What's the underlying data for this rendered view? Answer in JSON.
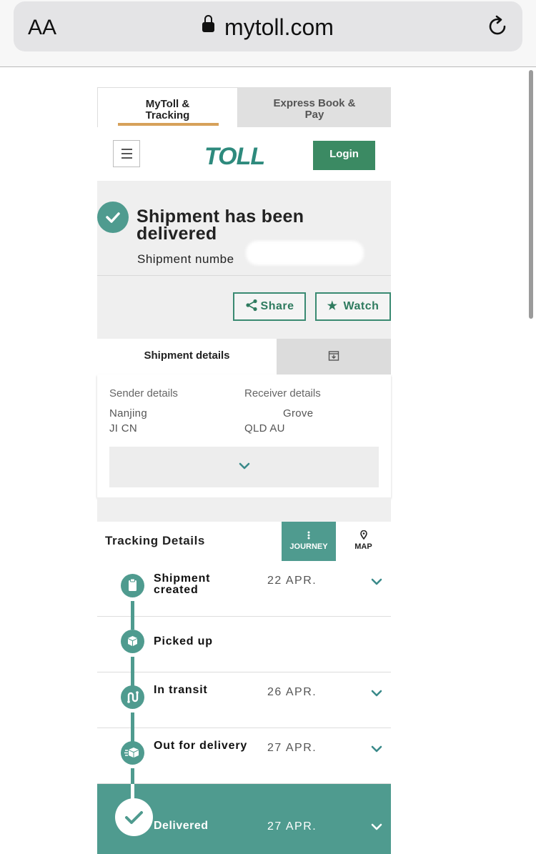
{
  "browser": {
    "text_size_label": "AA",
    "url": "mytoll.com"
  },
  "tabs": {
    "mytoll": "MyToll & Tracking",
    "express": "Express Book & Pay"
  },
  "header": {
    "logo": "TOLL",
    "login": "Login"
  },
  "status": {
    "title_line1": "Shipment has been",
    "title_line2": "delivered",
    "shipment_number_label": "Shipment numbe",
    "share": "Share",
    "watch": "Watch"
  },
  "details_tabs": {
    "shipment_details": "Shipment details"
  },
  "sender": {
    "label": "Sender details",
    "city": "Nanjing",
    "region": "JI CN"
  },
  "receiver": {
    "label": "Receiver details",
    "city": "Grove",
    "region": "QLD AU"
  },
  "tracking": {
    "title": "Tracking Details",
    "journey": "JOURNEY",
    "map": "MAP",
    "steps": [
      {
        "label_line1": "Shipment",
        "label_line2": "created",
        "date": "22 APR."
      },
      {
        "label_line1": "Picked up",
        "label_line2": "",
        "date": ""
      },
      {
        "label_line1": "In transit",
        "label_line2": "",
        "date": "26 APR."
      },
      {
        "label_line1": "Out for delivery",
        "label_line2": "",
        "date": "27 APR."
      },
      {
        "label_line1": "Delivered",
        "label_line2": "",
        "date": "27 APR."
      }
    ]
  },
  "colors": {
    "teal": "#4f9b8f",
    "green_button": "#3b8a63",
    "tab_underline": "#d6a15a"
  }
}
